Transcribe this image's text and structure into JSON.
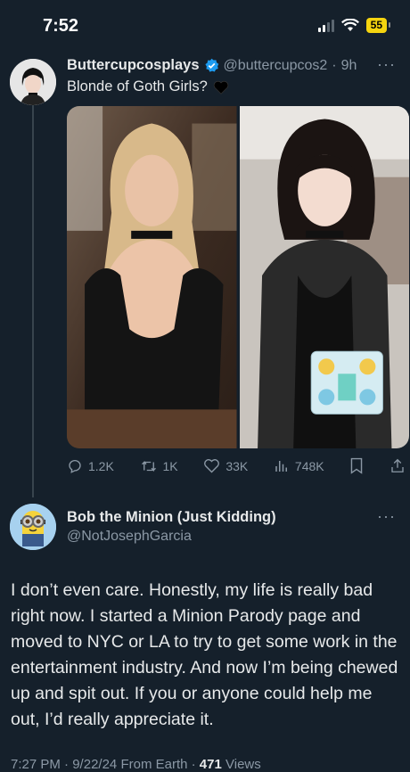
{
  "status_bar": {
    "time": "7:52",
    "battery": "55"
  },
  "tweet1": {
    "name": "Buttercupcosplays",
    "handle": "@buttercupcos2",
    "separator": "·",
    "time": "9h",
    "more": "···",
    "text": "Blonde of Goth Girls?",
    "actions": {
      "replies": "1.2K",
      "retweets": "1K",
      "likes": "33K",
      "views": "748K"
    }
  },
  "tweet2": {
    "name": "Bob the Minion (Just Kidding)",
    "handle": "@NotJosephGarcia",
    "more": "···",
    "text": "I don’t even care. Honestly, my life is really bad right now. I started a Minion Parody page and moved to NYC or LA to try to get some work in the entertainment industry. And now I’m being chewed up and spit out. If you or anyone could help me out, I’d really appreciate it.",
    "footer": {
      "time": "7:27 PM",
      "date": "9/22/24",
      "source": "From Earth",
      "views_count": "471",
      "views_label": "Views"
    }
  },
  "colors": {
    "background": "#15202b",
    "text": "#e7e9ea",
    "muted": "#8b98a5",
    "verified": "#1d9bf0"
  }
}
